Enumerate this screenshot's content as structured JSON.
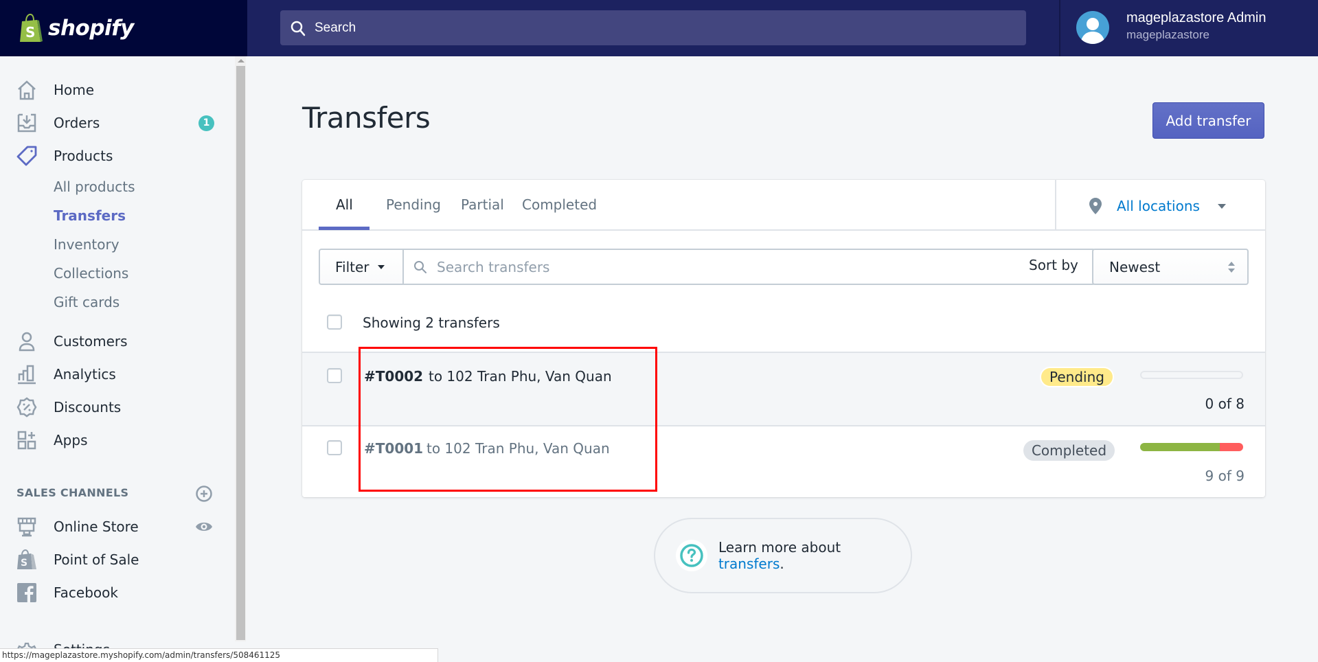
{
  "topbar": {
    "brand": "shopify",
    "search_placeholder": "Search",
    "user_name": "mageplazastore Admin",
    "user_store": "mageplazastore"
  },
  "sidebar": {
    "items": [
      {
        "label": "Home",
        "icon": "home-icon"
      },
      {
        "label": "Orders",
        "icon": "orders-icon",
        "badge": "1"
      },
      {
        "label": "Products",
        "icon": "tag-icon"
      }
    ],
    "product_subitems": [
      {
        "label": "All products",
        "active": false
      },
      {
        "label": "Transfers",
        "active": true
      },
      {
        "label": "Inventory",
        "active": false
      },
      {
        "label": "Collections",
        "active": false
      },
      {
        "label": "Gift cards",
        "active": false
      }
    ],
    "items2": [
      {
        "label": "Customers",
        "icon": "customers-icon"
      },
      {
        "label": "Analytics",
        "icon": "analytics-icon"
      },
      {
        "label": "Discounts",
        "icon": "discounts-icon"
      },
      {
        "label": "Apps",
        "icon": "apps-icon"
      }
    ],
    "sales_channels_title": "SALES CHANNELS",
    "channels": [
      {
        "label": "Online Store",
        "icon": "store-icon"
      },
      {
        "label": "Point of Sale",
        "icon": "pos-icon"
      },
      {
        "label": "Facebook",
        "icon": "facebook-icon"
      }
    ],
    "settings_label": "Settings"
  },
  "page": {
    "title": "Transfers",
    "add_button": "Add transfer"
  },
  "tabs": [
    "All",
    "Pending",
    "Partial",
    "Completed"
  ],
  "active_tab": "All",
  "locations": {
    "label": "All locations"
  },
  "filters": {
    "filter_label": "Filter",
    "search_placeholder": "Search transfers",
    "sort_label": "Sort by",
    "sort_value": "Newest"
  },
  "list": {
    "showing": "Showing 2 transfers",
    "rows": [
      {
        "id": "#T0002",
        "destination": "to 102 Tran Phu, Van Quan",
        "status": "Pending",
        "received": 0,
        "total": 8,
        "accepted_fraction": 0,
        "rejected_fraction": 0,
        "count_text": "0 of 8"
      },
      {
        "id": "#T0001",
        "destination": "to 102 Tran Phu, Van Quan",
        "status": "Completed",
        "received": 9,
        "total": 9,
        "accepted_fraction": 0.77,
        "rejected_fraction": 0.23,
        "count_text": "9 of 9"
      }
    ]
  },
  "learn_more": {
    "text": "Learn more about ",
    "link": "transfers",
    "suffix": "."
  },
  "status_url": "https://mageplazastore.myshopify.com/admin/transfers/508461125",
  "colors": {
    "accent": "#5c6ac4",
    "topbar": "#1c2260",
    "logo_bg": "#000639",
    "pending_badge": "#ffea8a",
    "completed_badge": "#dfe3e8",
    "progress_ok": "#8db543",
    "progress_bad": "#ff5d5d",
    "link": "#007ace",
    "annotation": "#ff0000"
  }
}
